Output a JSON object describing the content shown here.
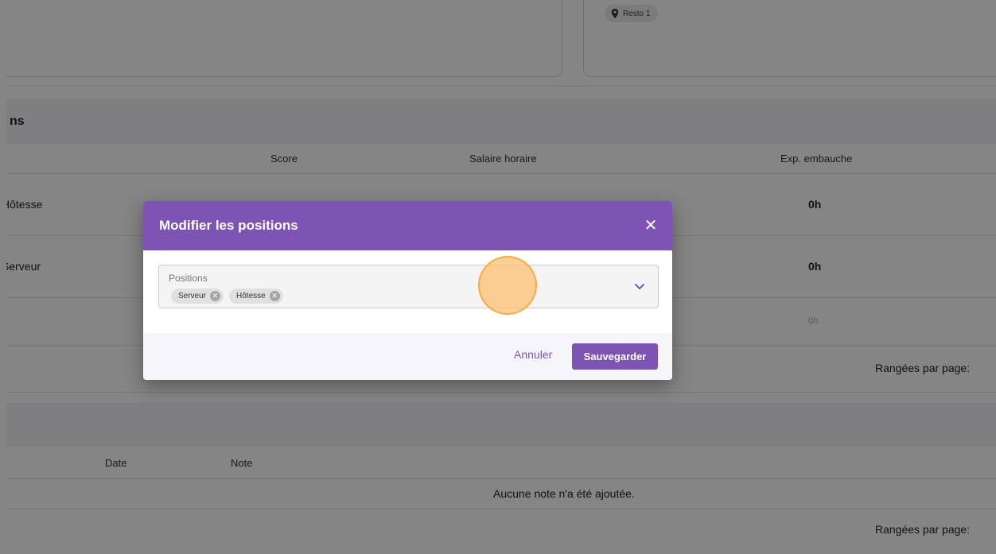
{
  "location_chip": {
    "icon": "map-pin-icon",
    "label": "Resto 1"
  },
  "positions_section": {
    "title": "ns",
    "columns": {
      "score": "Score",
      "hourly_wage": "Salaire horaire",
      "hire_exp": "Exp. embauche"
    },
    "rows": [
      {
        "position": "Hôtesse",
        "exp": "0h"
      },
      {
        "position": "Serveur",
        "exp": "0h"
      },
      {
        "position": "",
        "exp": "0h"
      }
    ],
    "rows_per_page_label": "Rangées par page:"
  },
  "notes_section": {
    "columns": {
      "date": "Date",
      "note": "Note"
    },
    "empty_text": "Aucune note n'a été ajoutée.",
    "rows_per_page_label": "Rangées par page:"
  },
  "dialog": {
    "title": "Modifier les positions",
    "close_icon": "close-icon",
    "field_label": "Positions",
    "selected": [
      "Serveur",
      "Hôtesse"
    ],
    "cancel_label": "Annuler",
    "save_label": "Sauvegarder"
  },
  "colors": {
    "accent": "#7d53b3",
    "overlay": "rgba(0,0,0,0.48)",
    "click_marker": "#ffbe6e"
  }
}
